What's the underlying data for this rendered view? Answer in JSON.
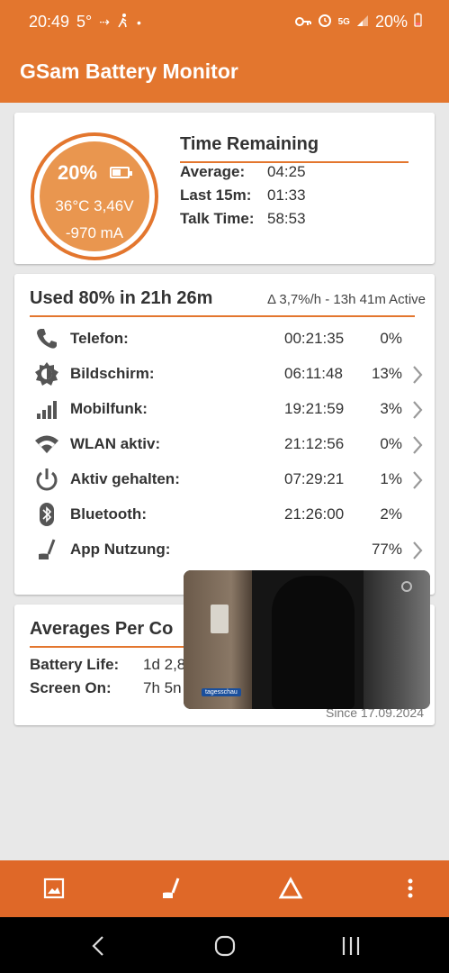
{
  "status_bar": {
    "time": "20:49",
    "temp": "5°",
    "battery": "20%",
    "icons": [
      "data-transfer-icon",
      "walking-icon",
      "dot-icon",
      "key-icon",
      "alarm-icon",
      "5g-icon",
      "signal-icon",
      "battery-icon"
    ]
  },
  "app": {
    "title": "GSam Battery Monitor"
  },
  "gauge": {
    "percent": "20%",
    "temperature_voltage": "36°C  3,46V",
    "current": "-970 mA",
    "level": 0.2
  },
  "time_remaining": {
    "title": "Time Remaining",
    "rows": [
      {
        "label": "Average:",
        "value": "04:25"
      },
      {
        "label": "Last 15m:",
        "value": "01:33"
      },
      {
        "label": "Talk Time:",
        "value": "58:53"
      }
    ]
  },
  "usage": {
    "title": "Used 80% in 21h 26m",
    "subtitle": "Δ 3,7%/h - 13h 41m Active",
    "rows": [
      {
        "name": "Telefon:",
        "time": "00:21:35",
        "percent": "0%",
        "icon": "phone-icon",
        "chevron": false
      },
      {
        "name": "Bildschirm:",
        "time": "06:11:48",
        "percent": "13%",
        "icon": "brightness-icon",
        "chevron": true
      },
      {
        "name": "Mobilfunk:",
        "time": "19:21:59",
        "percent": "3%",
        "icon": "signal-bars-icon",
        "chevron": true
      },
      {
        "name": "WLAN aktiv:",
        "time": "21:12:56",
        "percent": "0%",
        "icon": "wifi-icon",
        "chevron": true
      },
      {
        "name": "Aktiv gehalten:",
        "time": "07:29:21",
        "percent": "1%",
        "icon": "power-icon",
        "chevron": true
      },
      {
        "name": "Bluetooth:",
        "time": "21:26:00",
        "percent": "2%",
        "icon": "bluetooth-icon",
        "chevron": false
      },
      {
        "name": "App Nutzung:",
        "time": "",
        "percent": "77%",
        "icon": "app-usage-icon",
        "chevron": true
      }
    ]
  },
  "averages": {
    "title": "Averages Per Co",
    "rows": [
      {
        "label": "Battery Life:",
        "value": "1d 2,8"
      },
      {
        "label": "Screen On:",
        "value": "7h 5n"
      }
    ],
    "since": "Since 17.09.2024"
  },
  "video_overlay": {
    "logo_text": "tagesschau"
  },
  "bottom_bar": {
    "buttons": [
      "image-icon",
      "app-usage-icon",
      "delta-icon",
      "more-vert-icon"
    ]
  },
  "nav_bar": {
    "buttons": [
      "back-icon",
      "home-icon",
      "recents-icon"
    ]
  }
}
